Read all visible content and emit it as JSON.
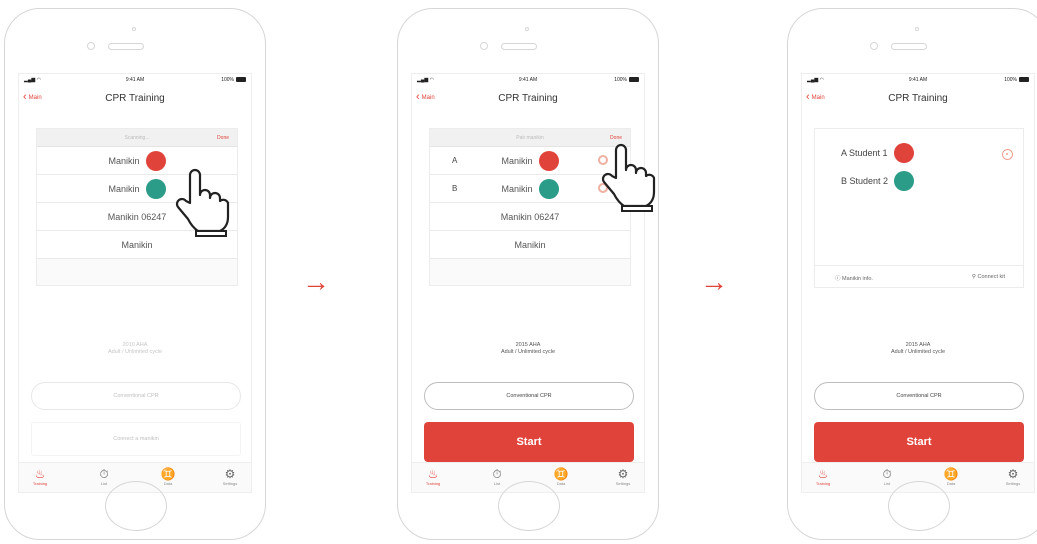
{
  "status": {
    "time": "9:41 AM",
    "battery": "100%"
  },
  "nav": {
    "back": "Main",
    "title": "CPR Training"
  },
  "screen1": {
    "scan": "Scanning...",
    "done": "Done",
    "rows": [
      "Manikin",
      "Manikin",
      "Manikin 06247",
      "Manikin"
    ],
    "cycle1": "2010 AHA",
    "cycle2": "Adult / Unlimited cycle",
    "mode": "Conventional CPR",
    "select": "Connect a manikin"
  },
  "screen2": {
    "scan": "Pair manikin",
    "done": "Done",
    "letters": [
      "A",
      "B"
    ],
    "rows": [
      "Manikin",
      "Manikin",
      "Manikin 06247",
      "Manikin"
    ],
    "cycle1": "2015 AHA",
    "cycle2": "Adult / Unlimited cycle",
    "mode": "Conventional CPR",
    "start": "Start"
  },
  "screen3": {
    "students": [
      "A  Student 1",
      "B  Student 2"
    ],
    "info": "Manikin info.",
    "connect": "Connect kit",
    "cycle1": "2015 AHA",
    "cycle2": "Adult / Unlimited cycle",
    "mode": "Conventional CPR",
    "start": "Start"
  },
  "tabs": [
    "Training",
    "List",
    "Data",
    "Settings"
  ],
  "icons": {
    "tab1": "cpr-person-icon",
    "tab2": "stopwatch-icon",
    "tab3": "people-icon",
    "tab4": "gear-icon",
    "arrow": "arrow-right-icon",
    "hand": "pointing-hand-icon"
  },
  "colors": {
    "accent": "#e0433a",
    "manikin_red": "#e0433a",
    "manikin_teal": "#2b9c87"
  }
}
